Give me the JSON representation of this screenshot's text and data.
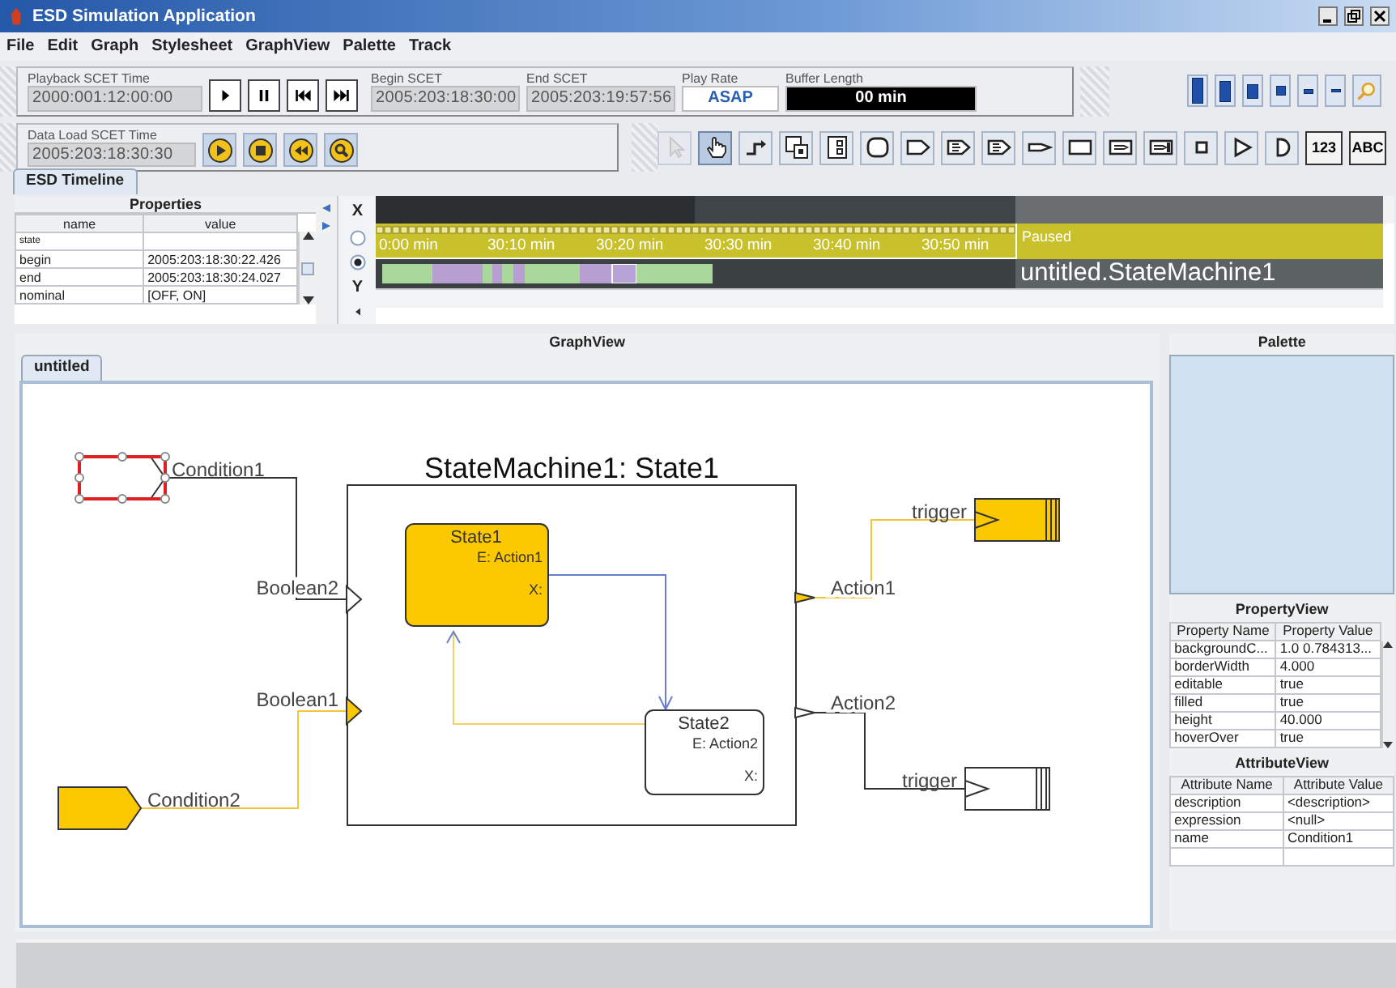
{
  "window": {
    "title": "ESD Simulation Application"
  },
  "menu": [
    "File",
    "Edit",
    "Graph",
    "Stylesheet",
    "GraphView",
    "Palette",
    "Track"
  ],
  "playback": {
    "label": "Playback SCET Time",
    "value": "2000:001:12:00:00",
    "buttons": [
      {
        "kind": "play"
      },
      {
        "kind": "pause"
      },
      {
        "kind": "rewind"
      },
      {
        "kind": "fast-forward"
      }
    ]
  },
  "begin_scet": {
    "label": "Begin SCET",
    "value": "2005:203:18:30:00"
  },
  "end_scet": {
    "label": "End SCET",
    "value": "2005:203:19:57:56"
  },
  "play_rate": {
    "label": "Play Rate",
    "value": "ASAP"
  },
  "buffer_length": {
    "label": "Buffer Length",
    "value": "00 min"
  },
  "zoom_buttons": [
    {
      "kind": "xl"
    },
    {
      "kind": "lg"
    },
    {
      "kind": "md"
    },
    {
      "kind": "sm"
    },
    {
      "kind": "xs"
    },
    {
      "kind": "line"
    },
    {
      "kind": "magnifier"
    }
  ],
  "data_load": {
    "label": "Data Load SCET Time",
    "value": "2005:203:18:30:30",
    "buttons": [
      {
        "kind": "play"
      },
      {
        "kind": "stop"
      },
      {
        "kind": "rewind"
      },
      {
        "kind": "search"
      }
    ]
  },
  "tools": [
    {
      "kind": "arrow",
      "selected": false,
      "disabled": true
    },
    {
      "kind": "hand",
      "selected": true,
      "disabled": false
    },
    {
      "kind": "connector",
      "selected": false,
      "disabled": false
    },
    {
      "kind": "group",
      "selected": false,
      "disabled": false
    },
    {
      "kind": "split",
      "selected": false,
      "disabled": false
    },
    {
      "kind": "rounded",
      "selected": false,
      "disabled": false
    },
    {
      "kind": "tag",
      "selected": false,
      "disabled": false
    },
    {
      "kind": "tag-lines",
      "selected": false,
      "disabled": false
    },
    {
      "kind": "tag-lines",
      "selected": false,
      "disabled": false
    },
    {
      "kind": "pointer",
      "selected": false,
      "disabled": false
    },
    {
      "kind": "rect",
      "selected": false,
      "disabled": false
    },
    {
      "kind": "box-arrow",
      "selected": false,
      "disabled": false
    },
    {
      "kind": "box-arrow-bar",
      "selected": false,
      "disabled": false
    },
    {
      "kind": "square",
      "selected": false,
      "disabled": false
    },
    {
      "kind": "triangle",
      "selected": false,
      "disabled": false
    },
    {
      "kind": "d-shape",
      "selected": false,
      "disabled": false
    },
    {
      "kind": "text",
      "label": "123",
      "selected": false,
      "disabled": false
    },
    {
      "kind": "text",
      "label": "ABC",
      "selected": false,
      "disabled": false
    }
  ],
  "timeline": {
    "tab": "ESD Timeline",
    "properties": {
      "title": "Properties",
      "columns": [
        "name",
        "value"
      ],
      "rows": [
        {
          "name": "state"
        },
        {
          "name": "begin",
          "value": "2005:203:18:30:22.426"
        },
        {
          "name": "end",
          "value": "2005:203:18:30:24.027"
        },
        {
          "name": "nominal",
          "value": "[OFF, ON]"
        }
      ]
    },
    "axis_x": "X",
    "axis_y": "Y",
    "radios": [
      {
        "selected": false
      },
      {
        "selected": true
      }
    ],
    "ticks": [
      "0:00 min",
      "30:10 min",
      "30:20 min",
      "30:30 min",
      "30:40 min",
      "30:50 min"
    ],
    "status": "Paused",
    "track_name": "untitled.StateMachine1"
  },
  "graph_view": {
    "title": "GraphView",
    "tab": "untitled",
    "machine_title": "StateMachine1: State1",
    "states": [
      {
        "name": "State1",
        "entry": "E: Action1",
        "exit": "X:",
        "filled": true
      },
      {
        "name": "State2",
        "entry": "E: Action2",
        "exit": "X:",
        "filled": false
      }
    ],
    "inputs": [
      {
        "label": "Condition1",
        "port": "Boolean2",
        "selected": true,
        "filled": false
      },
      {
        "label": "Condition2",
        "port": "Boolean1",
        "selected": false,
        "filled": true
      }
    ],
    "outputs": [
      {
        "port": "Action1",
        "label": "trigger",
        "filled": true
      },
      {
        "port": "Action2",
        "label": "trigger",
        "filled": false
      }
    ]
  },
  "palette": {
    "title": "Palette"
  },
  "property_view": {
    "title": "PropertyView",
    "columns": [
      "Property Name",
      "Property Value"
    ],
    "rows": [
      [
        "backgroundC...",
        "1.0 0.784313..."
      ],
      [
        "borderWidth",
        "4.000"
      ],
      [
        "editable",
        "true"
      ],
      [
        "filled",
        "true"
      ],
      [
        "height",
        "40.000"
      ],
      [
        "hoverOver",
        "true"
      ]
    ]
  },
  "attribute_view": {
    "title": "AttributeView",
    "columns": [
      "Attribute Name",
      "Attribute Value"
    ],
    "rows": [
      [
        "description",
        "<description>"
      ],
      [
        "expression",
        "<null>"
      ],
      [
        "name",
        "Condition1"
      ]
    ]
  }
}
